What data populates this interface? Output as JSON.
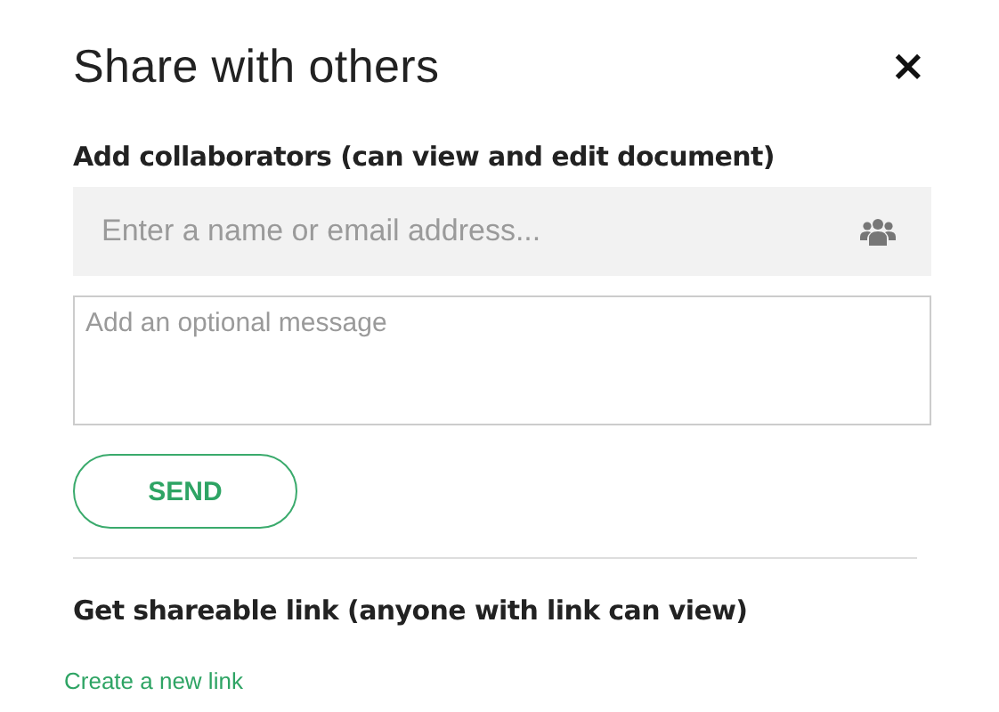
{
  "dialog": {
    "title": "Share with others",
    "close": "×"
  },
  "collaborators": {
    "heading": "Add collaborators (can view and edit document)",
    "name_field": {
      "placeholder": "Enter a name or email address..."
    },
    "message_field": {
      "placeholder": "Add an optional message"
    },
    "send_button": "SEND"
  },
  "link": {
    "heading": "Get shareable link (anyone with link can view)",
    "create_link": "Create a new link"
  }
}
